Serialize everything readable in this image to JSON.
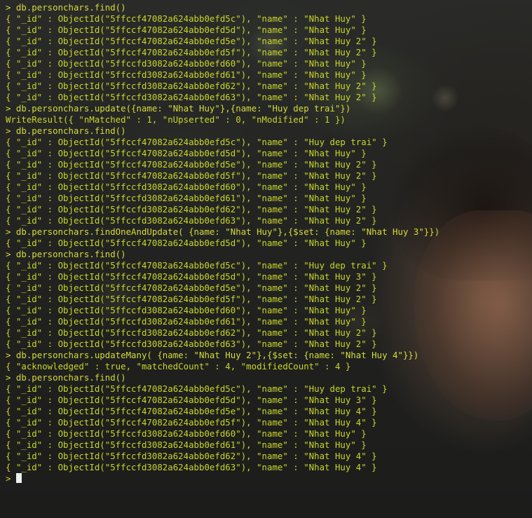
{
  "terminal": {
    "lines": [
      "> db.personchars.find()",
      "{ \"_id\" : ObjectId(\"5ffccf47082a624abb0efd5c\"), \"name\" : \"Nhat Huy\" }",
      "{ \"_id\" : ObjectId(\"5ffccf47082a624abb0efd5d\"), \"name\" : \"Nhat Huy\" }",
      "{ \"_id\" : ObjectId(\"5ffccf47082a624abb0efd5e\"), \"name\" : \"Nhat Huy 2\" }",
      "{ \"_id\" : ObjectId(\"5ffccf47082a624abb0efd5f\"), \"name\" : \"Nhat Huy 2\" }",
      "{ \"_id\" : ObjectId(\"5ffccfd3082a624abb0efd60\"), \"name\" : \"Nhat Huy\" }",
      "{ \"_id\" : ObjectId(\"5ffccfd3082a624abb0efd61\"), \"name\" : \"Nhat Huy\" }",
      "{ \"_id\" : ObjectId(\"5ffccfd3082a624abb0efd62\"), \"name\" : \"Nhat Huy 2\" }",
      "{ \"_id\" : ObjectId(\"5ffccfd3082a624abb0efd63\"), \"name\" : \"Nhat Huy 2\" }",
      "> db.personchars.update({name: \"Nhat Huy\"},{name: \"Huy dep trai\"})",
      "WriteResult({ \"nMatched\" : 1, \"nUpserted\" : 0, \"nModified\" : 1 })",
      "> db.personchars.find()",
      "{ \"_id\" : ObjectId(\"5ffccf47082a624abb0efd5c\"), \"name\" : \"Huy dep trai\" }",
      "{ \"_id\" : ObjectId(\"5ffccf47082a624abb0efd5d\"), \"name\" : \"Nhat Huy\" }",
      "{ \"_id\" : ObjectId(\"5ffccf47082a624abb0efd5e\"), \"name\" : \"Nhat Huy 2\" }",
      "{ \"_id\" : ObjectId(\"5ffccf47082a624abb0efd5f\"), \"name\" : \"Nhat Huy 2\" }",
      "{ \"_id\" : ObjectId(\"5ffccfd3082a624abb0efd60\"), \"name\" : \"Nhat Huy\" }",
      "{ \"_id\" : ObjectId(\"5ffccfd3082a624abb0efd61\"), \"name\" : \"Nhat Huy\" }",
      "{ \"_id\" : ObjectId(\"5ffccfd3082a624abb0efd62\"), \"name\" : \"Nhat Huy 2\" }",
      "{ \"_id\" : ObjectId(\"5ffccfd3082a624abb0efd63\"), \"name\" : \"Nhat Huy 2\" }",
      "> db.personchars.findOneAndUpdate( {name: \"Nhat Huy\"},{$set: {name: \"Nhat Huy 3\"}})",
      "{ \"_id\" : ObjectId(\"5ffccf47082a624abb0efd5d\"), \"name\" : \"Nhat Huy\" }",
      "> db.personchars.find()",
      "{ \"_id\" : ObjectId(\"5ffccf47082a624abb0efd5c\"), \"name\" : \"Huy dep trai\" }",
      "{ \"_id\" : ObjectId(\"5ffccf47082a624abb0efd5d\"), \"name\" : \"Nhat Huy 3\" }",
      "{ \"_id\" : ObjectId(\"5ffccf47082a624abb0efd5e\"), \"name\" : \"Nhat Huy 2\" }",
      "{ \"_id\" : ObjectId(\"5ffccf47082a624abb0efd5f\"), \"name\" : \"Nhat Huy 2\" }",
      "{ \"_id\" : ObjectId(\"5ffccfd3082a624abb0efd60\"), \"name\" : \"Nhat Huy\" }",
      "{ \"_id\" : ObjectId(\"5ffccfd3082a624abb0efd61\"), \"name\" : \"Nhat Huy\" }",
      "{ \"_id\" : ObjectId(\"5ffccfd3082a624abb0efd62\"), \"name\" : \"Nhat Huy 2\" }",
      "{ \"_id\" : ObjectId(\"5ffccfd3082a624abb0efd63\"), \"name\" : \"Nhat Huy 2\" }",
      "> db.personchars.updateMany( {name: \"Nhat Huy 2\"},{$set: {name: \"Nhat Huy 4\"}})",
      "{ \"acknowledged\" : true, \"matchedCount\" : 4, \"modifiedCount\" : 4 }",
      "> db.personchars.find()",
      "{ \"_id\" : ObjectId(\"5ffccf47082a624abb0efd5c\"), \"name\" : \"Huy dep trai\" }",
      "{ \"_id\" : ObjectId(\"5ffccf47082a624abb0efd5d\"), \"name\" : \"Nhat Huy 3\" }",
      "{ \"_id\" : ObjectId(\"5ffccf47082a624abb0efd5e\"), \"name\" : \"Nhat Huy 4\" }",
      "{ \"_id\" : ObjectId(\"5ffccf47082a624abb0efd5f\"), \"name\" : \"Nhat Huy 4\" }",
      "{ \"_id\" : ObjectId(\"5ffccfd3082a624abb0efd60\"), \"name\" : \"Nhat Huy\" }",
      "{ \"_id\" : ObjectId(\"5ffccfd3082a624abb0efd61\"), \"name\" : \"Nhat Huy\" }",
      "{ \"_id\" : ObjectId(\"5ffccfd3082a624abb0efd62\"), \"name\" : \"Nhat Huy 4\" }",
      "{ \"_id\" : ObjectId(\"5ffccfd3082a624abb0efd63\"), \"name\" : \"Nhat Huy 4\" }"
    ],
    "prompt": ">",
    "text_color": "#c9d62a",
    "cursor_color": "#ecf0ee"
  }
}
